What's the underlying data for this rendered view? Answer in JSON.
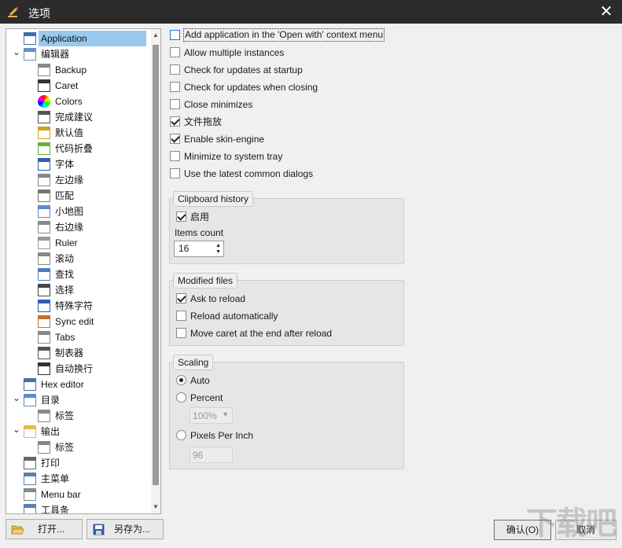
{
  "window": {
    "title": "选项",
    "close_icon": "close-icon"
  },
  "tree": {
    "items": [
      {
        "label": "Application",
        "icon": "window-icon",
        "selected": true
      },
      {
        "label": "编辑器",
        "icon": "editor-icon",
        "expanded": true
      },
      {
        "label": "Backup",
        "icon": "backup-icon"
      },
      {
        "label": "Caret",
        "icon": "caret-icon"
      },
      {
        "label": "Colors",
        "icon": "color-wheel-icon"
      },
      {
        "label": "完成建议",
        "icon": "completion-icon"
      },
      {
        "label": "默认值",
        "icon": "defaults-icon"
      },
      {
        "label": "代码折叠",
        "icon": "folding-icon"
      },
      {
        "label": "字体",
        "icon": "font-icon"
      },
      {
        "label": "左边缘",
        "icon": "left-gutter-icon"
      },
      {
        "label": "匹配",
        "icon": "match-icon"
      },
      {
        "label": "小地图",
        "icon": "minimap-icon"
      },
      {
        "label": "右边缘",
        "icon": "right-margin-icon"
      },
      {
        "label": "Ruler",
        "icon": "ruler-icon"
      },
      {
        "label": "滚动",
        "icon": "scroll-icon"
      },
      {
        "label": "查找",
        "icon": "search-icon"
      },
      {
        "label": "选择",
        "icon": "cursor-icon"
      },
      {
        "label": "特殊字符",
        "icon": "pilcrow-icon"
      },
      {
        "label": "Sync edit",
        "icon": "sync-edit-icon"
      },
      {
        "label": "Tabs",
        "icon": "tabs-icon"
      },
      {
        "label": "制表器",
        "icon": "tabulator-icon"
      },
      {
        "label": "自动换行",
        "icon": "word-wrap-icon"
      },
      {
        "label": "Hex editor",
        "icon": "hex-icon"
      },
      {
        "label": "目录",
        "icon": "directory-icon",
        "expanded": true
      },
      {
        "label": "标签",
        "icon": "tag-icon"
      },
      {
        "label": "输出",
        "icon": "folder-icon",
        "expanded": true
      },
      {
        "label": "标签",
        "icon": "tag-icon"
      },
      {
        "label": "打印",
        "icon": "printer-icon"
      },
      {
        "label": "主菜单",
        "icon": "main-menu-icon"
      },
      {
        "label": "Menu bar",
        "icon": "menubar-icon"
      },
      {
        "label": "工具条",
        "icon": "toolbar-icon"
      }
    ]
  },
  "options": [
    {
      "label": "Add application in the 'Open with' context menu",
      "checked": false
    },
    {
      "label": "Allow multiple instances",
      "checked": false
    },
    {
      "label": "Check for updates at startup",
      "checked": false
    },
    {
      "label": "Check for updates when closing",
      "checked": false
    },
    {
      "label": "Close minimizes",
      "checked": false
    },
    {
      "label": "文件拖放",
      "checked": true
    },
    {
      "label": "Enable skin-engine",
      "checked": true
    },
    {
      "label": "Minimize to system tray",
      "checked": false
    },
    {
      "label": "Use the latest common dialogs",
      "checked": false
    }
  ],
  "clipboard": {
    "title": "Clipboard history",
    "enable_label": "启用",
    "enabled": true,
    "count_label": "Items count",
    "count_value": "16"
  },
  "modified": {
    "title": "Modified files",
    "items": [
      {
        "label": "Ask to reload",
        "checked": true
      },
      {
        "label": "Reload automatically",
        "checked": false
      },
      {
        "label": "Move caret at the end after reload",
        "checked": false
      }
    ]
  },
  "scaling": {
    "title": "Scaling",
    "auto_label": "Auto",
    "auto_selected": true,
    "percent_label": "Percent",
    "percent_value": "100%",
    "ppi_label": "Pixels Per Inch",
    "ppi_value": "96"
  },
  "buttons": {
    "open": "打开...",
    "save_as": "另存为...",
    "ok": "确认(O)",
    "cancel": "取消"
  },
  "watermark": "下载吧"
}
